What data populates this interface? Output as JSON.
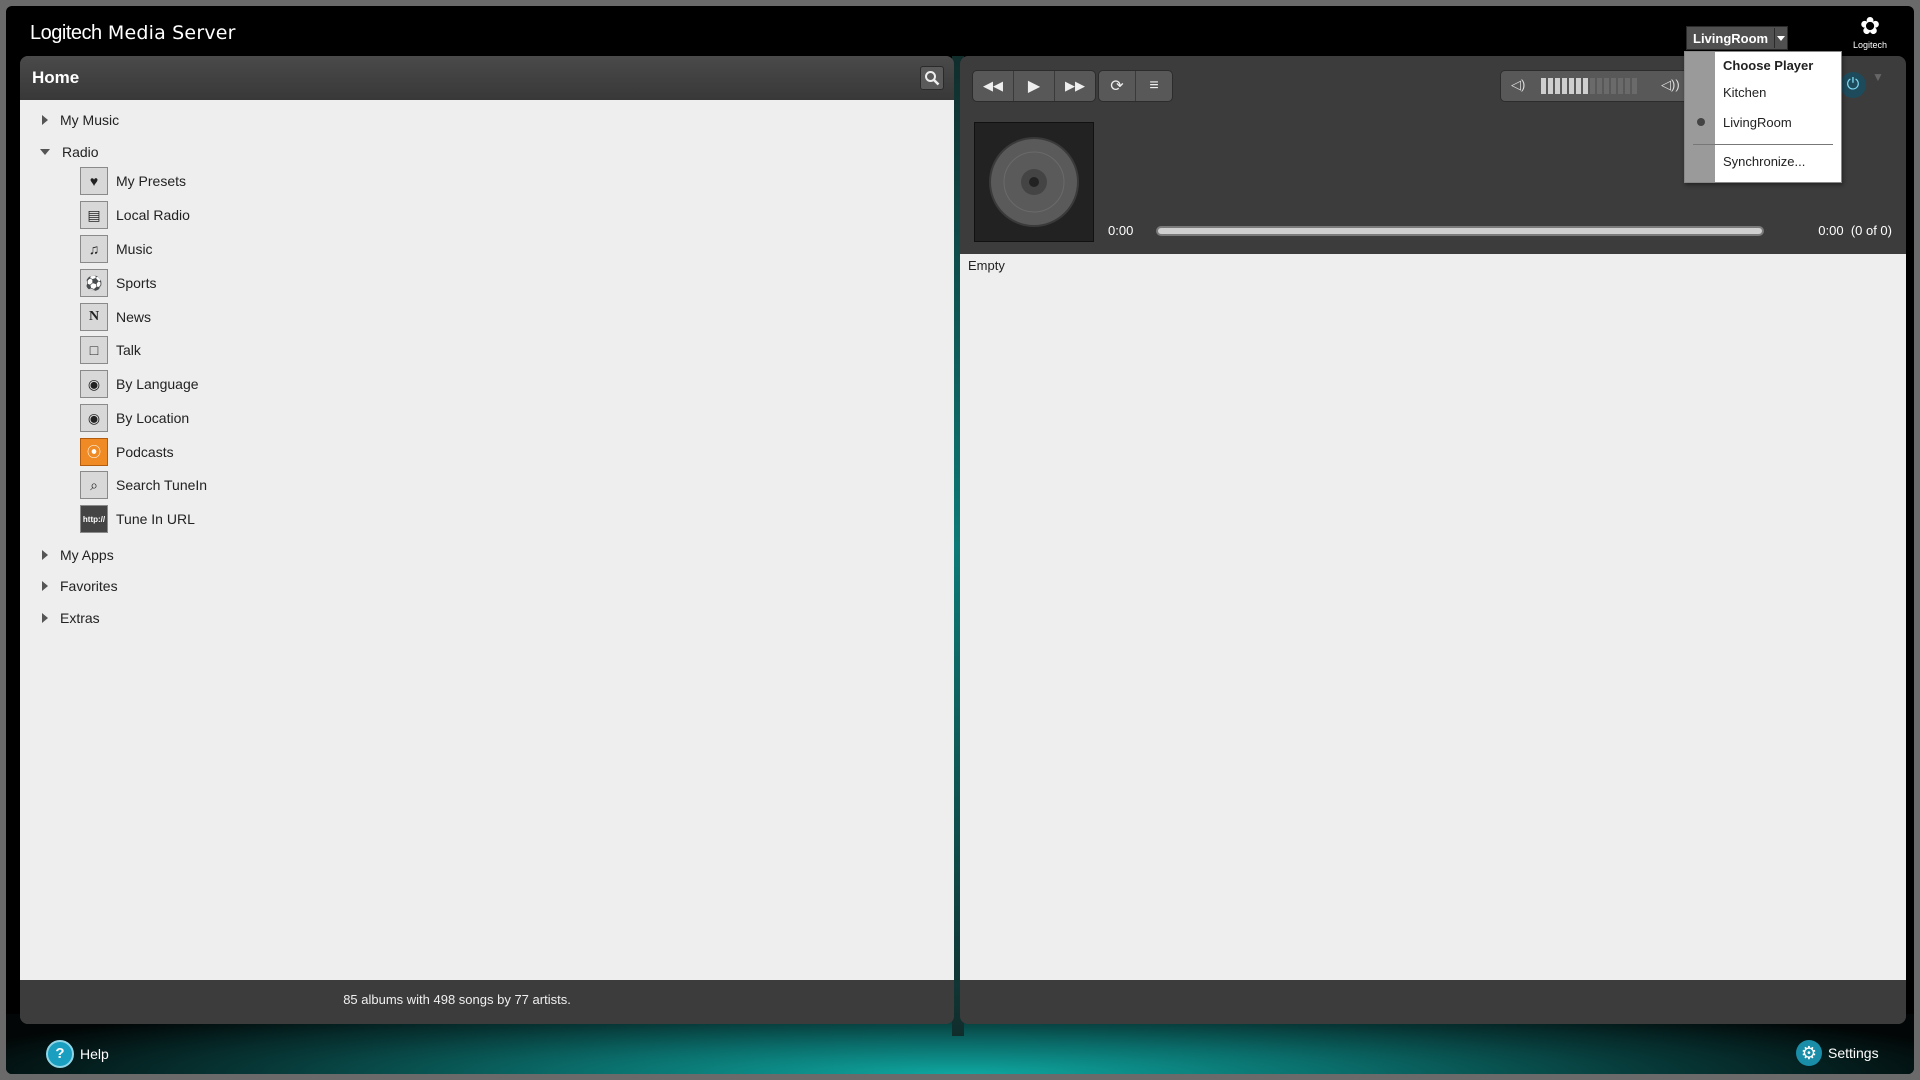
{
  "app": {
    "title_brand": "Logitech",
    "title_rest": " Media Server",
    "logo_text": "Logitech"
  },
  "left_panel": {
    "title": "Home",
    "tree": [
      {
        "label": "My Music",
        "expanded": false
      },
      {
        "label": "Radio",
        "expanded": true
      },
      {
        "label": "My Apps",
        "expanded": false
      },
      {
        "label": "Favorites",
        "expanded": false
      },
      {
        "label": "Extras",
        "expanded": false
      }
    ],
    "radio_items": [
      {
        "label": "My Presets",
        "icon": "heart-icon"
      },
      {
        "label": "Local Radio",
        "icon": "local-radio-icon"
      },
      {
        "label": "Music",
        "icon": "music-notes-icon"
      },
      {
        "label": "Sports",
        "icon": "soccer-ball-icon"
      },
      {
        "label": "News",
        "icon": "news-icon"
      },
      {
        "label": "Talk",
        "icon": "speech-bubble-icon"
      },
      {
        "label": "By Language",
        "icon": "globe-icon"
      },
      {
        "label": "By Location",
        "icon": "globe-icon"
      },
      {
        "label": "Podcasts",
        "icon": "rss-icon"
      },
      {
        "label": "Search TuneIn",
        "icon": "magnifier-icon"
      },
      {
        "label": "Tune In URL",
        "icon": "http-icon"
      }
    ],
    "status": "85 albums with 498 songs by 77 artists."
  },
  "player": {
    "time_elapsed": "0:00",
    "time_total": "0:00",
    "track_position": "(0 of 0)",
    "progress_percent": 0,
    "volume_level_segments": 7,
    "volume_total_segments": 14,
    "playlist_empty_text": "Empty"
  },
  "player_select": {
    "current": "LivingRoom",
    "dropdown": {
      "heading": "Choose Player",
      "options": [
        "Kitchen",
        "LivingRoom"
      ],
      "selected": "LivingRoom",
      "sync": "Synchronize..."
    }
  },
  "footer": {
    "help": "Help",
    "settings": "Settings"
  },
  "colors": {
    "accent_teal": "#0fa6a0",
    "panel_dark": "#3c3c3c",
    "content_bg": "#eeeeee"
  }
}
